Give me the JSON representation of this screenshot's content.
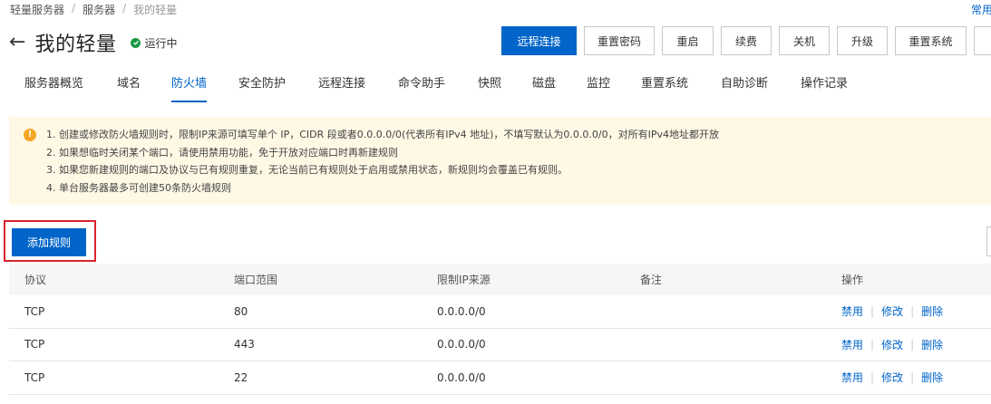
{
  "breadcrumb": [
    "轻量服务器",
    "服务器",
    "我的轻量"
  ],
  "top_right_link": "常用",
  "header": {
    "title": "我的轻量",
    "status": "运行中"
  },
  "actions": [
    "远程连接",
    "重置密码",
    "重启",
    "续费",
    "关机",
    "升级",
    "重置系统"
  ],
  "tabs": [
    "服务器概览",
    "域名",
    "防火墙",
    "安全防护",
    "远程连接",
    "命令助手",
    "快照",
    "磁盘",
    "监控",
    "重置系统",
    "自助诊断",
    "操作记录"
  ],
  "active_tab": "防火墙",
  "notice": {
    "lines": [
      "1. 创建或修改防火墙规则时，限制IP来源可填写单个 IP，CIDR 段或者0.0.0.0/0(代表所有IPv4 地址)，不填写默认为0.0.0.0/0，对所有IPv4地址都开放",
      "2. 如果想临时关闭某个端口，请使用禁用功能，免于开放对应端口时再新建规则",
      "3. 如果您新建规则的端口及协议与已有规则重复，无论当前已有规则处于启用或禁用状态，新规则均会覆盖已有规则。",
      "4. 单台服务器最多可创建50条防火墙规则"
    ]
  },
  "add_rule_label": "添加规则",
  "table": {
    "columns": [
      "协议",
      "端口范围",
      "限制IP来源",
      "备注",
      "操作"
    ],
    "rows": [
      {
        "protocol": "TCP",
        "port": "80",
        "source": "0.0.0.0/0",
        "note": ""
      },
      {
        "protocol": "TCP",
        "port": "443",
        "source": "0.0.0.0/0",
        "note": ""
      },
      {
        "protocol": "TCP",
        "port": "22",
        "source": "0.0.0.0/0",
        "note": ""
      }
    ],
    "ops": [
      "禁用",
      "修改",
      "删除"
    ]
  },
  "colors": {
    "primary": "#0064c8",
    "status_green": "#1a9a45",
    "notice_bg": "#fff8e5",
    "notice_icon": "#f5a623",
    "highlight_border": "#d9232e"
  }
}
